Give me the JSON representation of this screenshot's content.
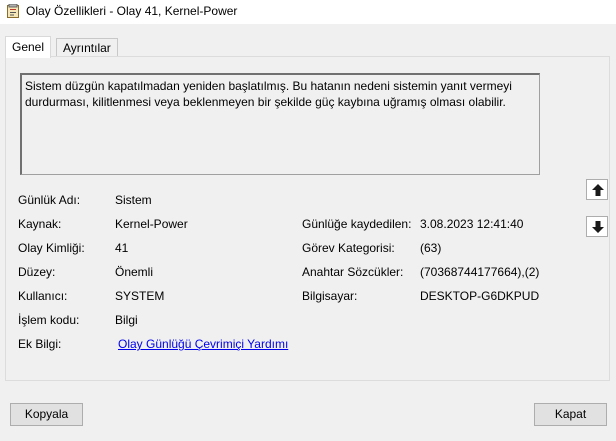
{
  "window": {
    "title": "Olay Özellikleri - Olay 41, Kernel-Power"
  },
  "tabs": [
    {
      "label": "Genel"
    },
    {
      "label": "Ayrıntılar"
    }
  ],
  "description": "Sistem düzgün kapatılmadan yeniden başlatılmış. Bu hatanın nedeni sistemin yanıt vermeyi\ndurdurması, kilitlenmesi veya beklenmeyen bir şekilde güç kaybına uğramış olması olabilir.",
  "fields": {
    "log_name": {
      "label": "Günlük Adı:",
      "value": "Sistem"
    },
    "source": {
      "label": "Kaynak:",
      "value": "Kernel-Power"
    },
    "event_id": {
      "label": "Olay Kimliği:",
      "value": "41"
    },
    "level": {
      "label": "Düzey:",
      "value": "Önemli"
    },
    "user": {
      "label": "Kullanıcı:",
      "value": "SYSTEM"
    },
    "opcode": {
      "label": "İşlem kodu:",
      "value": "Bilgi"
    },
    "more_info": {
      "label": "Ek Bilgi:",
      "value": "Olay Günlüğü Çevrimiçi Yardımı"
    },
    "logged": {
      "label": "Günlüğe kaydedilen:",
      "value": "3.08.2023 12:41:40"
    },
    "task_category": {
      "label": "Görev Kategorisi:",
      "value": "(63)"
    },
    "keywords": {
      "label": "Anahtar Sözcükler:",
      "value": "(70368744177664),(2)"
    },
    "computer": {
      "label": "Bilgisayar:",
      "value": "DESKTOP-G6DKPUD"
    }
  },
  "nav": {
    "up_icon": "arrow-up-icon",
    "down_icon": "arrow-down-icon"
  },
  "buttons": {
    "copy": "Kopyala",
    "close": "Kapat"
  },
  "colors": {
    "link": "#0000ee",
    "background": "#f0f0f0"
  }
}
